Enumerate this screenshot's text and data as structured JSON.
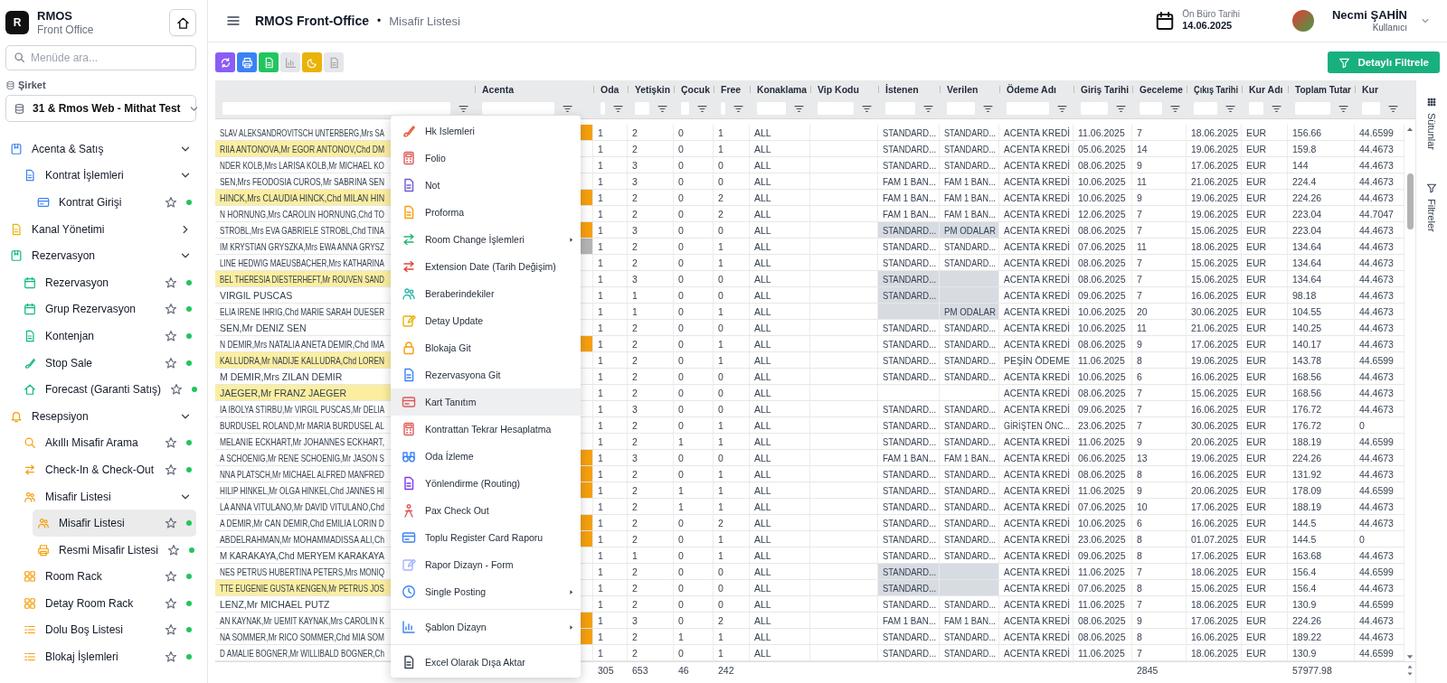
{
  "sidebar": {
    "logo": "R",
    "app_name": "RMOS",
    "app_subtitle": "Front Office",
    "search": {
      "placeholder": "Menüde ara..."
    },
    "company_label": "Şirket",
    "company": "31 & Rmos Web - Mithat Test",
    "nav": [
      {
        "kind": "group",
        "label": "Acenta & Satış",
        "expanded": true,
        "children": [
          {
            "kind": "group",
            "label": "Kontrat İşlemleri",
            "expanded": true,
            "children": [
              {
                "kind": "link",
                "label": "Kontrat Girişi",
                "favorite": false,
                "selected": false
              }
            ]
          }
        ]
      },
      {
        "kind": "group",
        "label": "Kanal Yönetimi",
        "expanded": false
      },
      {
        "kind": "group",
        "label": "Rezervasyon",
        "expanded": true,
        "children": [
          {
            "kind": "link",
            "label": "Rezervasyon",
            "favorite": false,
            "selected": false
          },
          {
            "kind": "link",
            "label": "Grup Rezervasyon",
            "favorite": false,
            "selected": false
          },
          {
            "kind": "link",
            "label": "Kontenjan",
            "favorite": false,
            "selected": false
          },
          {
            "kind": "link",
            "label": "Stop Sale",
            "favorite": false,
            "selected": false
          },
          {
            "kind": "link",
            "label": "Forecast (Garanti Satış)",
            "favorite": false,
            "selected": false
          }
        ]
      },
      {
        "kind": "group",
        "label": "Resepsiyon",
        "expanded": true,
        "children": [
          {
            "kind": "link",
            "label": "Akıllı Misafir Arama",
            "favorite": false,
            "selected": false
          },
          {
            "kind": "link",
            "label": "Check-In & Check-Out",
            "favorite": false,
            "selected": false
          },
          {
            "kind": "group",
            "label": "Misafir Listesi",
            "expanded": true,
            "children": [
              {
                "kind": "link",
                "label": "Misafir Listesi",
                "favorite": false,
                "selected": true
              },
              {
                "kind": "link",
                "label": "Resmi Misafir Listesi",
                "favorite": false,
                "selected": false
              }
            ]
          },
          {
            "kind": "link",
            "label": "Room Rack",
            "favorite": false,
            "selected": false
          },
          {
            "kind": "link",
            "label": "Detay Room Rack",
            "favorite": false,
            "selected": false
          },
          {
            "kind": "link",
            "label": "Dolu Boş Listesi",
            "favorite": false,
            "selected": false
          },
          {
            "kind": "link",
            "label": "Blokaj İşlemleri",
            "favorite": false,
            "selected": false
          }
        ]
      }
    ]
  },
  "header": {
    "title": "RMOS Front-Office",
    "separator": "•",
    "page": "Misafir Listesi",
    "date_label": "Ön Büro Tarihi",
    "date": "14.06.2025",
    "user_name": "Necmi ŞAHİN",
    "user_role": "Kullanıcı"
  },
  "toolbar": {
    "buttons": [
      {
        "disabled": false
      },
      {
        "disabled": false
      },
      {
        "disabled": false
      },
      {
        "disabled": true
      },
      {
        "disabled": false
      },
      {
        "disabled": true
      }
    ],
    "filter_button": "Detaylı Filtrele"
  },
  "grid": {
    "columns": [
      "Acenta",
      "Oda",
      "Yetişkin",
      "Çocuk",
      "Free",
      "Konaklama",
      "Vip Kodu",
      "İstenen",
      "Verilen",
      "Ödeme Adı",
      "Giriş Tarihi",
      "Geceleme",
      "Çıkış Tarihi",
      "Kur Adı",
      "Toplam Tutar",
      "Kur"
    ],
    "rows": [
      {
        "guest": "SLAV ALEKSANDROVITSCH UNTERBERG,Mrs SA",
        "highlighted": false,
        "color": "#f5a00f",
        "oda": "1",
        "yetiskin": "2",
        "cocuk": "0",
        "free": "1",
        "konaklama": "ALL",
        "istenen": "STANDARD...",
        "verilen": "STANDARD...",
        "room_mismatch": false,
        "odeme": "ACENTA KREDİ",
        "giris": "11.06.2025",
        "geceleme": "7",
        "cikis": "18.06.2025",
        "kur_adi": "EUR",
        "toplam": "156.66",
        "kur": "44.6599"
      },
      {
        "guest": "RIIA ANTONOVA,Mr EGOR ANTONOV,Chd DM",
        "highlighted": true,
        "oda": "1",
        "yetiskin": "2",
        "cocuk": "0",
        "free": "1",
        "konaklama": "ALL",
        "istenen": "STANDARD...",
        "verilen": "STANDARD...",
        "room_mismatch": false,
        "odeme": "ACENTA KREDİ",
        "giris": "05.06.2025",
        "geceleme": "14",
        "cikis": "19.06.2025",
        "kur_adi": "EUR",
        "toplam": "159.8",
        "kur": "44.4673"
      },
      {
        "guest": "NDER KOLB,Mrs LARISA KOLB,Mr MICHAEL KO",
        "highlighted": false,
        "oda": "1",
        "yetiskin": "3",
        "cocuk": "0",
        "free": "0",
        "konaklama": "ALL",
        "istenen": "STANDARD...",
        "verilen": "STANDARD...",
        "room_mismatch": false,
        "odeme": "ACENTA KREDİ",
        "giris": "08.06.2025",
        "geceleme": "9",
        "cikis": "17.06.2025",
        "kur_adi": "EUR",
        "toplam": "144",
        "kur": "44.4673"
      },
      {
        "guest": "SEN,Mrs FEODOSIA CUROS,Mr SABRINA SEN",
        "highlighted": false,
        "oda": "1",
        "yetiskin": "3",
        "cocuk": "0",
        "free": "0",
        "konaklama": "ALL",
        "istenen": "FAM 1 BAN...",
        "verilen": "FAM 1 BAN...",
        "room_mismatch": false,
        "odeme": "ACENTA KREDİ",
        "giris": "10.06.2025",
        "geceleme": "11",
        "cikis": "21.06.2025",
        "kur_adi": "EUR",
        "toplam": "224.4",
        "kur": "44.4673"
      },
      {
        "guest": "HINCK,Mrs CLAUDIA HINCK,Chd MILAN HIN",
        "highlighted": true,
        "color": "#f5a00f",
        "oda": "1",
        "yetiskin": "2",
        "cocuk": "0",
        "free": "2",
        "konaklama": "ALL",
        "istenen": "FAM 1 BAN...",
        "verilen": "FAM 1 BAN...",
        "room_mismatch": false,
        "odeme": "ACENTA KREDİ",
        "giris": "10.06.2025",
        "geceleme": "9",
        "cikis": "19.06.2025",
        "kur_adi": "EUR",
        "toplam": "224.26",
        "kur": "44.4673"
      },
      {
        "guest": "N HORNUNG,Mrs CAROLIN HORNUNG,Chd TO",
        "highlighted": false,
        "oda": "1",
        "yetiskin": "2",
        "cocuk": "0",
        "free": "2",
        "konaklama": "ALL",
        "istenen": "FAM 1 BAN...",
        "verilen": "FAM 1 BAN...",
        "room_mismatch": false,
        "odeme": "ACENTA KREDİ",
        "giris": "12.06.2025",
        "geceleme": "7",
        "cikis": "19.06.2025",
        "kur_adi": "EUR",
        "toplam": "223.04",
        "kur": "44.7047"
      },
      {
        "guest": "STROBL,Mrs EVA GABRIELE STROBL,Chd TINA",
        "highlighted": false,
        "color": "#f5a00f",
        "oda": "1",
        "yetiskin": "3",
        "cocuk": "0",
        "free": "0",
        "konaklama": "ALL",
        "istenen": "STANDARD...",
        "verilen": "PM ODALAR",
        "room_mismatch": true,
        "odeme": "ACENTA KREDİ",
        "giris": "08.06.2025",
        "geceleme": "7",
        "cikis": "15.06.2025",
        "kur_adi": "EUR",
        "toplam": "223.04",
        "kur": "44.4673"
      },
      {
        "guest": "IM KRYSTIAN GRYSZKA,Mrs EWA ANNA GRYSZ",
        "highlighted": false,
        "color": "#b5b5b5",
        "oda": "1",
        "yetiskin": "2",
        "cocuk": "0",
        "free": "1",
        "konaklama": "ALL",
        "istenen": "STANDARD...",
        "verilen": "STANDARD...",
        "room_mismatch": false,
        "odeme": "ACENTA KREDİ",
        "giris": "07.06.2025",
        "geceleme": "11",
        "cikis": "18.06.2025",
        "kur_adi": "EUR",
        "toplam": "134.64",
        "kur": "44.4673"
      },
      {
        "guest": "LINE HEDWIG MAEUSBACHER,Mrs KATHARINA",
        "highlighted": false,
        "oda": "1",
        "yetiskin": "2",
        "cocuk": "0",
        "free": "1",
        "konaklama": "ALL",
        "istenen": "STANDARD...",
        "verilen": "STANDARD...",
        "room_mismatch": false,
        "odeme": "ACENTA KREDİ",
        "giris": "08.06.2025",
        "geceleme": "7",
        "cikis": "15.06.2025",
        "kur_adi": "EUR",
        "toplam": "134.64",
        "kur": "44.4673"
      },
      {
        "guest": "BEL THERESIA DIESTERHEFT,Mr ROUVEN SAND",
        "highlighted": true,
        "oda": "1",
        "yetiskin": "3",
        "cocuk": "0",
        "free": "0",
        "konaklama": "ALL",
        "istenen": "STANDARD...",
        "room_mismatch": true,
        "odeme": "ACENTA KREDİ",
        "giris": "08.06.2025",
        "geceleme": "7",
        "cikis": "15.06.2025",
        "kur_adi": "EUR",
        "toplam": "134.64",
        "kur": "44.4673"
      },
      {
        "guest": "VIRGIL PUSCAS",
        "highlighted": false,
        "oda": "1",
        "yetiskin": "1",
        "cocuk": "0",
        "free": "0",
        "konaklama": "ALL",
        "istenen": "STANDARD...",
        "room_mismatch": true,
        "odeme": "ACENTA KREDİ",
        "giris": "09.06.2025",
        "geceleme": "7",
        "cikis": "16.06.2025",
        "kur_adi": "EUR",
        "toplam": "98.18",
        "kur": "44.4673"
      },
      {
        "guest": "ELIA IRENE IHRIG,Chd MARIE SARAH DUESER",
        "highlighted": false,
        "oda": "1",
        "yetiskin": "1",
        "cocuk": "0",
        "free": "1",
        "konaklama": "ALL",
        "verilen": "PM ODALAR",
        "room_mismatch": true,
        "odeme": "ACENTA KREDİ",
        "giris": "10.06.2025",
        "geceleme": "20",
        "cikis": "30.06.2025",
        "kur_adi": "EUR",
        "toplam": "104.55",
        "kur": "44.4673"
      },
      {
        "guest": "SEN,Mr DENIZ SEN",
        "highlighted": false,
        "oda": "1",
        "yetiskin": "2",
        "cocuk": "0",
        "free": "0",
        "konaklama": "ALL",
        "istenen": "STANDARD...",
        "verilen": "STANDARD...",
        "room_mismatch": false,
        "odeme": "ACENTA KREDİ",
        "giris": "10.06.2025",
        "geceleme": "11",
        "cikis": "21.06.2025",
        "kur_adi": "EUR",
        "toplam": "140.25",
        "kur": "44.4673"
      },
      {
        "guest": "N DEMIR,Mrs NATALIA ANETA DEMIR,Chd IMA",
        "highlighted": false,
        "color": "#f5a00f",
        "oda": "1",
        "yetiskin": "2",
        "cocuk": "0",
        "free": "1",
        "konaklama": "ALL",
        "istenen": "STANDARD...",
        "verilen": "STANDARD...",
        "room_mismatch": false,
        "odeme": "ACENTA KREDİ",
        "giris": "08.06.2025",
        "geceleme": "9",
        "cikis": "17.06.2025",
        "kur_adi": "EUR",
        "toplam": "140.17",
        "kur": "44.4673"
      },
      {
        "guest": "KALLUDRA,Mr NADIJE KALLUDRA,Chd LOREN",
        "highlighted": true,
        "oda": "1",
        "yetiskin": "2",
        "cocuk": "0",
        "free": "1",
        "konaklama": "ALL",
        "istenen": "STANDARD...",
        "verilen": "STANDARD...",
        "room_mismatch": false,
        "odeme": "PEŞİN ÖDEME",
        "giris": "11.06.2025",
        "geceleme": "8",
        "cikis": "19.06.2025",
        "kur_adi": "EUR",
        "toplam": "143.78",
        "kur": "44.6599"
      },
      {
        "guest": "M DEMIR,Mrs ZILAN DEMIR",
        "highlighted": false,
        "oda": "1",
        "yetiskin": "2",
        "cocuk": "0",
        "free": "0",
        "konaklama": "ALL",
        "istenen": "STANDARD...",
        "verilen": "STANDARD...",
        "room_mismatch": false,
        "odeme": "ACENTA KREDİ",
        "giris": "10.06.2025",
        "geceleme": "6",
        "cikis": "16.06.2025",
        "kur_adi": "EUR",
        "toplam": "168.56",
        "kur": "44.4673"
      },
      {
        "guest": "JAEGER,Mr FRANZ JAEGER",
        "highlighted": true,
        "oda": "1",
        "yetiskin": "2",
        "cocuk": "0",
        "free": "0",
        "konaklama": "ALL",
        "room_mismatch": false,
        "odeme": "ACENTA KREDİ",
        "giris": "08.06.2025",
        "geceleme": "7",
        "cikis": "15.06.2025",
        "kur_adi": "EUR",
        "toplam": "168.56",
        "kur": "44.4673"
      },
      {
        "guest": "IA IBOLYA STIRBU,Mr VIRGIL PUSCAS,Mr DELIA",
        "highlighted": false,
        "oda": "1",
        "yetiskin": "3",
        "cocuk": "0",
        "free": "0",
        "konaklama": "ALL",
        "istenen": "STANDARD...",
        "verilen": "STANDARD...",
        "room_mismatch": false,
        "odeme": "ACENTA KREDİ",
        "giris": "09.06.2025",
        "geceleme": "7",
        "cikis": "16.06.2025",
        "kur_adi": "EUR",
        "toplam": "176.72",
        "kur": "44.4673"
      },
      {
        "guest": "BURDUSEL ROLAND,Mr MARIA BURDUSEL AL",
        "highlighted": false,
        "oda": "1",
        "yetiskin": "2",
        "cocuk": "0",
        "free": "1",
        "konaklama": "ALL",
        "istenen": "STANDARD...",
        "verilen": "STANDARD...",
        "room_mismatch": false,
        "odeme": "GİRİŞTEN ÖNC...",
        "giris": "23.06.2025",
        "geceleme": "7",
        "cikis": "30.06.2025",
        "kur_adi": "EUR",
        "toplam": "176.72",
        "kur": "0"
      },
      {
        "guest": "MELANIE ECKHART,Mr JOHANNES ECKHART,",
        "highlighted": false,
        "oda": "1",
        "yetiskin": "2",
        "cocuk": "1",
        "free": "1",
        "konaklama": "ALL",
        "istenen": "STANDARD...",
        "verilen": "STANDARD...",
        "room_mismatch": false,
        "odeme": "ACENTA KREDİ",
        "giris": "11.06.2025",
        "geceleme": "9",
        "cikis": "20.06.2025",
        "kur_adi": "EUR",
        "toplam": "188.19",
        "kur": "44.6599"
      },
      {
        "guest": "A SCHOENIG,Mr RENE SCHOENIG,Mr JASON S",
        "highlighted": false,
        "color": "#f5a00f",
        "oda": "1",
        "yetiskin": "3",
        "cocuk": "0",
        "free": "0",
        "konaklama": "ALL",
        "istenen": "FAM 1 BAN...",
        "verilen": "FAM 1 BAN...",
        "room_mismatch": false,
        "odeme": "ACENTA KREDİ",
        "giris": "06.06.2025",
        "geceleme": "13",
        "cikis": "19.06.2025",
        "kur_adi": "EUR",
        "toplam": "224.26",
        "kur": "44.4673"
      },
      {
        "guest": "NNA PLATSCH,Mr MICHAEL ALFRED MANFRED",
        "highlighted": false,
        "color": "#f5a00f",
        "oda": "1",
        "yetiskin": "2",
        "cocuk": "0",
        "free": "1",
        "konaklama": "ALL",
        "istenen": "STANDARD...",
        "verilen": "STANDARD...",
        "room_mismatch": false,
        "odeme": "ACENTA KREDİ",
        "giris": "08.06.2025",
        "geceleme": "8",
        "cikis": "16.06.2025",
        "kur_adi": "EUR",
        "toplam": "131.92",
        "kur": "44.4673"
      },
      {
        "guest": "HILIP HINKEL,Mr OLGA HINKEL,Chd JANNES HI",
        "highlighted": false,
        "color": "#f5a00f",
        "oda": "1",
        "yetiskin": "2",
        "cocuk": "1",
        "free": "1",
        "konaklama": "ALL",
        "istenen": "STANDARD...",
        "verilen": "STANDARD...",
        "room_mismatch": false,
        "odeme": "ACENTA KREDİ",
        "giris": "11.06.2025",
        "geceleme": "9",
        "cikis": "20.06.2025",
        "kur_adi": "EUR",
        "toplam": "178.09",
        "kur": "44.6599"
      },
      {
        "guest": "LA ANNA VITULANO,Mr DAVID VITULANO,Chd",
        "highlighted": false,
        "oda": "1",
        "yetiskin": "2",
        "cocuk": "1",
        "free": "1",
        "konaklama": "ALL",
        "istenen": "STANDARD...",
        "verilen": "STANDARD...",
        "room_mismatch": false,
        "odeme": "ACENTA KREDİ",
        "giris": "07.06.2025",
        "geceleme": "10",
        "cikis": "17.06.2025",
        "kur_adi": "EUR",
        "toplam": "188.19",
        "kur": "44.4673"
      },
      {
        "guest": "A DEMIR,Mr CAN DEMIR,Chd EMILIA LORIN D",
        "highlighted": false,
        "color": "#f5a00f",
        "oda": "1",
        "yetiskin": "2",
        "cocuk": "0",
        "free": "2",
        "konaklama": "ALL",
        "istenen": "STANDARD...",
        "verilen": "STANDARD...",
        "room_mismatch": false,
        "odeme": "ACENTA KREDİ",
        "giris": "10.06.2025",
        "geceleme": "6",
        "cikis": "16.06.2025",
        "kur_adi": "EUR",
        "toplam": "144.5",
        "kur": "44.4673"
      },
      {
        "guest": "ABDELRAHMAN,Mr MOHAMMADISSA ALI,Ch",
        "highlighted": false,
        "color": "#f5a00f",
        "oda": "1",
        "yetiskin": "2",
        "cocuk": "0",
        "free": "1",
        "konaklama": "ALL",
        "istenen": "STANDARD...",
        "verilen": "STANDARD...",
        "room_mismatch": false,
        "odeme": "ACENTA KREDİ",
        "giris": "23.06.2025",
        "geceleme": "8",
        "cikis": "01.07.2025",
        "kur_adi": "EUR",
        "toplam": "144.5",
        "kur": "0"
      },
      {
        "guest": "M KARAKAYA,Chd MERYEM KARAKAYA",
        "highlighted": false,
        "oda": "1",
        "yetiskin": "1",
        "cocuk": "0",
        "free": "1",
        "konaklama": "ALL",
        "istenen": "STANDARD...",
        "verilen": "STANDARD...",
        "room_mismatch": false,
        "odeme": "ACENTA KREDİ",
        "giris": "09.06.2025",
        "geceleme": "8",
        "cikis": "17.06.2025",
        "kur_adi": "EUR",
        "toplam": "163.68",
        "kur": "44.4673"
      },
      {
        "guest": "NES PETRUS HUBERTINA PETERS,Mrs MONIQ",
        "highlighted": false,
        "oda": "1",
        "yetiskin": "2",
        "cocuk": "0",
        "free": "0",
        "konaklama": "ALL",
        "istenen": "STANDARD...",
        "room_mismatch": true,
        "odeme": "ACENTA KREDİ",
        "giris": "11.06.2025",
        "geceleme": "7",
        "cikis": "18.06.2025",
        "kur_adi": "EUR",
        "toplam": "156.4",
        "kur": "44.6599"
      },
      {
        "guest": "TTE EUGENIE GUSTA KENGEN,Mr PETRUS JOS",
        "highlighted": true,
        "oda": "1",
        "yetiskin": "2",
        "cocuk": "0",
        "free": "0",
        "konaklama": "ALL",
        "istenen": "STANDARD...",
        "room_mismatch": true,
        "odeme": "ACENTA KREDİ",
        "giris": "07.06.2025",
        "geceleme": "8",
        "cikis": "15.06.2025",
        "kur_adi": "EUR",
        "toplam": "156.4",
        "kur": "44.4673"
      },
      {
        "guest": "LENZ,Mr MICHAEL PUTZ",
        "highlighted": false,
        "oda": "1",
        "yetiskin": "2",
        "cocuk": "0",
        "free": "0",
        "konaklama": "ALL",
        "istenen": "STANDARD...",
        "verilen": "STANDARD...",
        "room_mismatch": false,
        "odeme": "ACENTA KREDİ",
        "giris": "11.06.2025",
        "geceleme": "7",
        "cikis": "18.06.2025",
        "kur_adi": "EUR",
        "toplam": "130.9",
        "kur": "44.6599"
      },
      {
        "guest": "AN KAYNAK,Mr UEMIT KAYNAK,Mrs CAROLIN K",
        "highlighted": false,
        "color": "#f5a00f",
        "oda": "1",
        "yetiskin": "3",
        "cocuk": "0",
        "free": "2",
        "konaklama": "ALL",
        "istenen": "FAM 1 BAN...",
        "verilen": "FAM 1 BAN...",
        "room_mismatch": false,
        "odeme": "ACENTA KREDİ",
        "giris": "08.06.2025",
        "geceleme": "9",
        "cikis": "17.06.2025",
        "kur_adi": "EUR",
        "toplam": "224.26",
        "kur": "44.4673"
      },
      {
        "guest": "NA SOMMER,Mr RICO SOMMER,Chd MIA SOM",
        "highlighted": false,
        "color": "#f5a00f",
        "oda": "1",
        "yetiskin": "2",
        "cocuk": "1",
        "free": "1",
        "konaklama": "ALL",
        "istenen": "STANDARD...",
        "verilen": "STANDARD...",
        "room_mismatch": false,
        "odeme": "ACENTA KREDİ",
        "giris": "08.06.2025",
        "geceleme": "8",
        "cikis": "16.06.2025",
        "kur_adi": "EUR",
        "toplam": "189.22",
        "kur": "44.4673"
      },
      {
        "guest": "D AMALIE BOGNER,Mr WILLIBALD BOGNER,Ch",
        "highlighted": false,
        "oda": "1",
        "yetiskin": "2",
        "cocuk": "0",
        "free": "1",
        "konaklama": "ALL",
        "istenen": "STANDARD...",
        "verilen": "STANDARD...",
        "room_mismatch": false,
        "odeme": "ACENTA KREDİ",
        "giris": "11.06.2025",
        "geceleme": "7",
        "cikis": "18.06.2025",
        "kur_adi": "EUR",
        "toplam": "130.9",
        "kur": "44.6599"
      }
    ],
    "totals": {
      "oda": "305",
      "yetiskin": "653",
      "cocuk": "46",
      "free": "242",
      "geceleme": "2845",
      "toplam": "57977.98"
    }
  },
  "context_menu": {
    "groups": [
      [
        {
          "label": "Hk Islemleri",
          "submenu": false,
          "hovered": false
        },
        {
          "label": "Folio",
          "submenu": false,
          "hovered": false
        },
        {
          "label": "Not",
          "submenu": false,
          "hovered": false
        },
        {
          "label": "Proforma",
          "submenu": false,
          "hovered": false
        },
        {
          "label": "Room Change İşlemleri",
          "submenu": true,
          "hovered": false
        },
        {
          "label": "Extension Date (Tarih Değişim)",
          "submenu": false,
          "hovered": false
        },
        {
          "label": "Beraberindekiler",
          "submenu": false,
          "hovered": false
        },
        {
          "label": "Detay Update",
          "submenu": false,
          "hovered": false
        },
        {
          "label": "Blokaja Git",
          "submenu": false,
          "hovered": false
        },
        {
          "label": "Rezervasyona Git",
          "submenu": false,
          "hovered": false
        },
        {
          "label": "Kart Tanıtım",
          "submenu": false,
          "hovered": true
        },
        {
          "label": "Kontrattan Tekrar Hesaplatma",
          "submenu": false,
          "hovered": false
        },
        {
          "label": "Oda İzleme",
          "submenu": false,
          "hovered": false
        },
        {
          "label": "Yönlendirme (Routing)",
          "submenu": false,
          "hovered": false
        },
        {
          "label": "Pax Check Out",
          "submenu": false,
          "hovered": false
        },
        {
          "label": "Toplu Register Card Raporu",
          "submenu": false,
          "hovered": false
        },
        {
          "label": "Rapor Dizayn - Form",
          "submenu": false,
          "hovered": false
        },
        {
          "label": "Single Posting",
          "submenu": true,
          "hovered": false
        }
      ],
      [
        {
          "label": "Şablon Dizayn",
          "submenu": true,
          "hovered": false
        }
      ],
      [
        {
          "label": "Excel Olarak Dışa Aktar",
          "submenu": false,
          "hovered": false
        }
      ]
    ]
  },
  "side_panel": {
    "tabs": [
      {
        "label": "Sütunlar"
      },
      {
        "label": "Filtreler"
      }
    ]
  }
}
